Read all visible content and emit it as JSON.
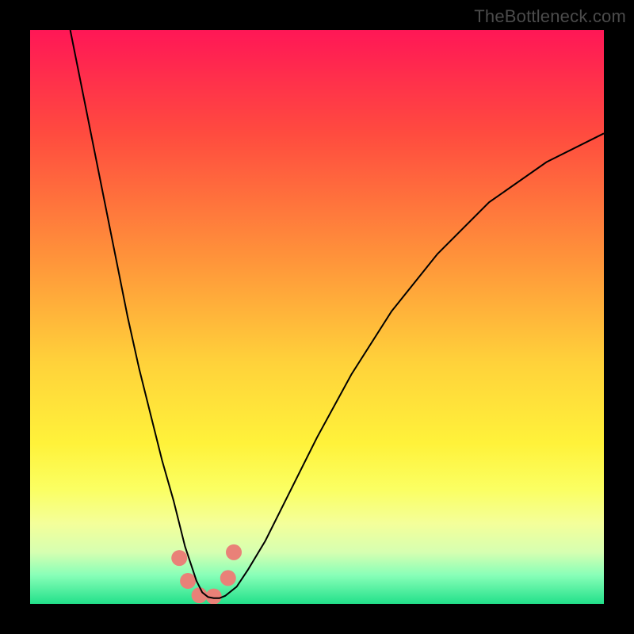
{
  "watermark": {
    "text": "TheBottleneck.com"
  },
  "chart_data": {
    "type": "line",
    "title": "",
    "xlabel": "",
    "ylabel": "",
    "xlim": [
      0,
      100
    ],
    "ylim": [
      0,
      100
    ],
    "grid": false,
    "background_gradient": {
      "stops": [
        {
          "pos": 0.0,
          "color": "#ff1756"
        },
        {
          "pos": 0.18,
          "color": "#ff4b3f"
        },
        {
          "pos": 0.4,
          "color": "#ff943a"
        },
        {
          "pos": 0.58,
          "color": "#ffd23a"
        },
        {
          "pos": 0.72,
          "color": "#fff23a"
        },
        {
          "pos": 0.8,
          "color": "#fbff62"
        },
        {
          "pos": 0.86,
          "color": "#f4ff9a"
        },
        {
          "pos": 0.91,
          "color": "#d6ffb1"
        },
        {
          "pos": 0.95,
          "color": "#88ffb8"
        },
        {
          "pos": 1.0,
          "color": "#22e08a"
        }
      ]
    },
    "series": [
      {
        "name": "bottleneck-curve",
        "color": "#000000",
        "x": [
          7,
          9,
          11,
          13,
          15,
          17,
          19,
          21,
          23,
          25,
          26,
          27,
          28,
          29,
          30,
          31,
          32,
          33,
          34,
          36,
          38,
          41,
          45,
          50,
          56,
          63,
          71,
          80,
          90,
          100
        ],
        "y": [
          100,
          90,
          80,
          70,
          60,
          50,
          41,
          33,
          25,
          18,
          14,
          10,
          7,
          4,
          2,
          1.2,
          1.0,
          1.0,
          1.4,
          3,
          6,
          11,
          19,
          29,
          40,
          51,
          61,
          70,
          77,
          82
        ]
      }
    ],
    "markers": {
      "name": "highlight-dots",
      "color": "#e98178",
      "radius_px": 10,
      "points": [
        {
          "x": 26,
          "y": 8
        },
        {
          "x": 27.5,
          "y": 4
        },
        {
          "x": 29.5,
          "y": 1.5
        },
        {
          "x": 32,
          "y": 1.3
        },
        {
          "x": 34.5,
          "y": 4.5
        },
        {
          "x": 35.5,
          "y": 9
        }
      ]
    }
  }
}
